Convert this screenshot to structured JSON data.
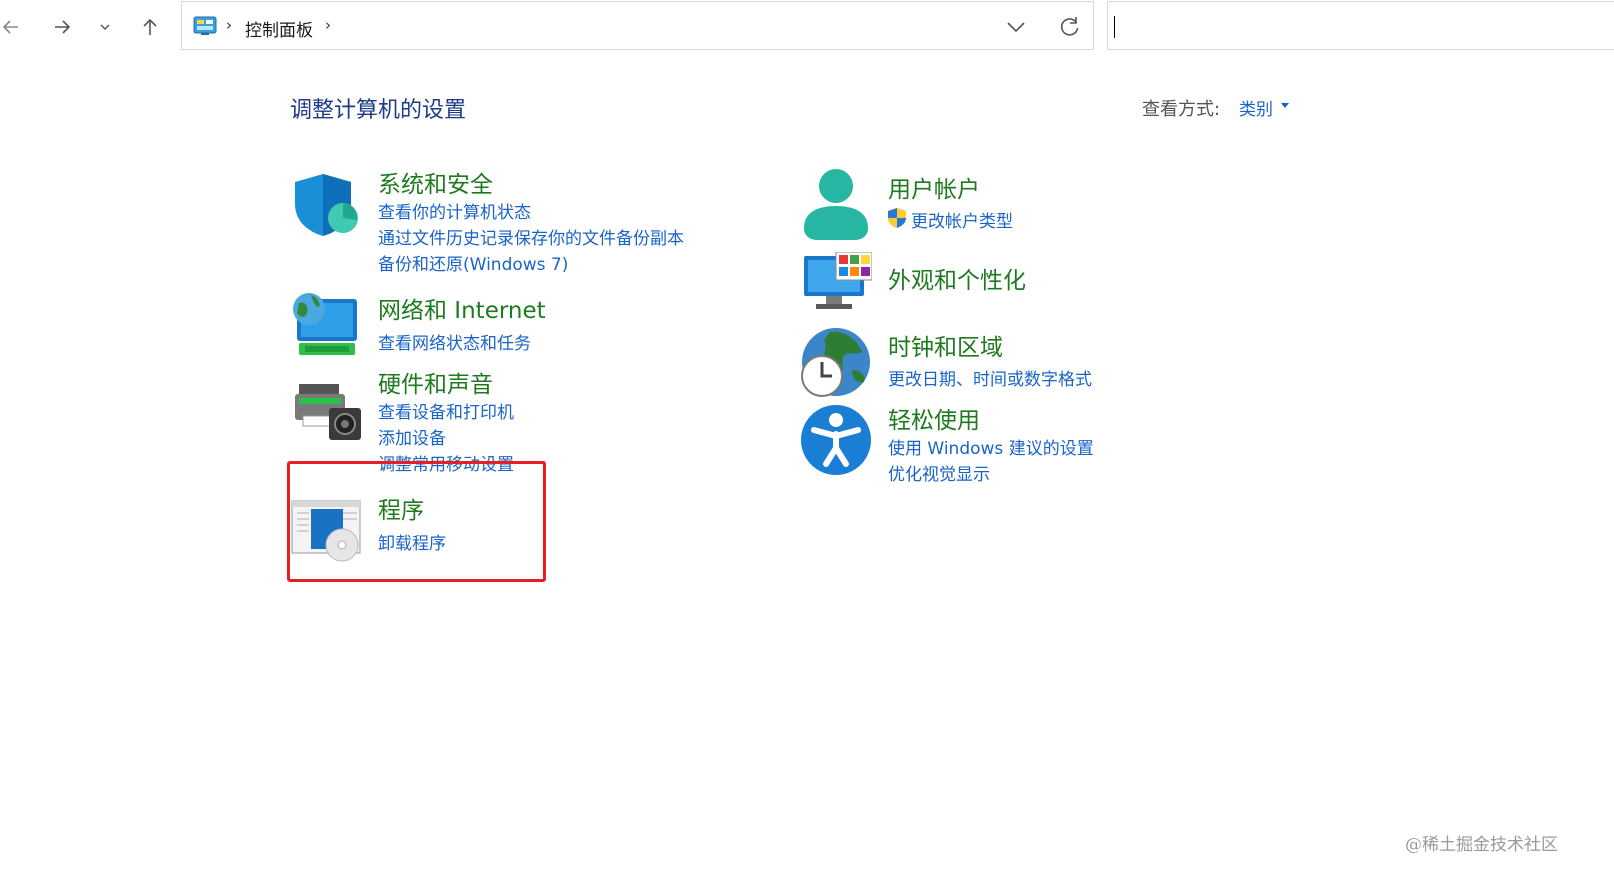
{
  "toolbar": {
    "back_icon": "arrow-left-icon",
    "forward_icon": "arrow-right-icon",
    "recent_icon": "chevron-down-icon",
    "up_icon": "arrow-up-icon"
  },
  "address": {
    "icon": "control-panel-icon",
    "separator": "›",
    "crumb": "控制面板",
    "dropdown_icon": "chevron-down-icon",
    "refresh_icon": "refresh-icon"
  },
  "search": {
    "value": "",
    "placeholder": ""
  },
  "header": {
    "title": "调整计算机的设置",
    "view_by_label": "查看方式:",
    "view_by_value": "类别"
  },
  "categories_left": [
    {
      "title": "系统和安全",
      "icon": "shield-icon",
      "links": [
        "查看你的计算机状态",
        "通过文件历史记录保存你的文件备份副本",
        "备份和还原(Windows 7)"
      ]
    },
    {
      "title": "网络和 Internet",
      "icon": "network-globe-monitor-icon",
      "links": [
        "查看网络状态和任务"
      ]
    },
    {
      "title": "硬件和声音",
      "icon": "printer-speaker-icon",
      "links": [
        "查看设备和打印机",
        "添加设备",
        "调整常用移动设置"
      ]
    },
    {
      "title": "程序",
      "icon": "programs-disc-icon",
      "links": [
        "卸载程序"
      ]
    }
  ],
  "categories_right": [
    {
      "title": "用户帐户",
      "icon": "user-icon",
      "links": [
        "更改帐户类型"
      ]
    },
    {
      "title": "外观和个性化",
      "icon": "monitor-palette-icon",
      "links": []
    },
    {
      "title": "时钟和区域",
      "icon": "globe-clock-icon",
      "links": [
        "更改日期、时间或数字格式"
      ]
    },
    {
      "title": "轻松使用",
      "icon": "accessibility-icon",
      "links": [
        "使用 Windows 建议的设置",
        "优化视觉显示"
      ]
    }
  ],
  "colors": {
    "category_title": "#1f7a1f",
    "link": "#1a64c8",
    "page_title": "#1e3a8a",
    "highlight": "#e61e25"
  },
  "watermark": "@稀土掘金技术社区"
}
